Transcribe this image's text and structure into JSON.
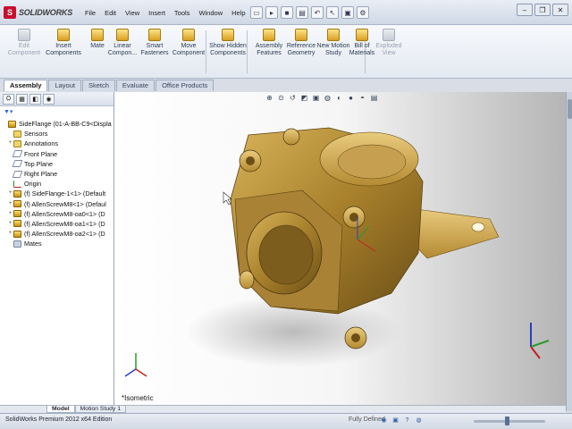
{
  "app": {
    "title": "SOLIDWORKS",
    "logo_mark": "S"
  },
  "menu": [
    "File",
    "Edit",
    "View",
    "Insert",
    "Tools",
    "Window",
    "Help"
  ],
  "quick_access": [
    "new-icon",
    "open-icon",
    "save-icon",
    "print-icon",
    "undo-icon",
    "select-icon",
    "rebuild-icon",
    "options-icon"
  ],
  "window_controls": [
    "minimize-icon",
    "restore-icon",
    "close-icon"
  ],
  "commands": [
    {
      "label": "Edit Component",
      "icon": "edit-component-icon",
      "enabled": false
    },
    {
      "label": "Insert Components",
      "icon": "insert-components-icon",
      "enabled": true
    },
    {
      "label": "Mate",
      "icon": "mate-icon",
      "enabled": true
    },
    {
      "label": "Linear Compon...",
      "icon": "linear-pattern-icon",
      "enabled": true
    },
    {
      "label": "Smart Fasteners",
      "icon": "smart-fasteners-icon",
      "enabled": true
    },
    {
      "label": "Move Component",
      "icon": "move-component-icon",
      "enabled": true
    },
    {
      "label": "Show Hidden Components",
      "icon": "show-hidden-icon",
      "enabled": true
    },
    {
      "label": "Assembly Features",
      "icon": "assembly-features-icon",
      "enabled": true
    },
    {
      "label": "Reference Geometry",
      "icon": "reference-geometry-icon",
      "enabled": true
    },
    {
      "label": "New Motion Study",
      "icon": "motion-study-icon",
      "enabled": true
    },
    {
      "label": "Bill of Materials",
      "icon": "bom-icon",
      "enabled": true
    },
    {
      "label": "Exploded View",
      "icon": "exploded-view-icon",
      "enabled": false
    }
  ],
  "tabs": [
    {
      "label": "Assembly",
      "active": true
    },
    {
      "label": "Layout",
      "active": false
    },
    {
      "label": "Sketch",
      "active": false
    },
    {
      "label": "Evaluate",
      "active": false
    },
    {
      "label": "Office Products",
      "active": false
    }
  ],
  "feature_tree": [
    {
      "label": "SideFlange  (01-A-BB-C9<Displa",
      "icon": "assembly",
      "expander": "",
      "indent": 0
    },
    {
      "label": "Sensors",
      "icon": "folder",
      "expander": "",
      "indent": 1
    },
    {
      "label": "Annotations",
      "icon": "folder",
      "expander": "+",
      "indent": 1
    },
    {
      "label": "Front Plane",
      "icon": "plane",
      "expander": "",
      "indent": 1
    },
    {
      "label": "Top Plane",
      "icon": "plane",
      "expander": "",
      "indent": 1
    },
    {
      "label": "Right Plane",
      "icon": "plane",
      "expander": "",
      "indent": 1
    },
    {
      "label": "Origin",
      "icon": "origin",
      "expander": "",
      "indent": 1
    },
    {
      "label": "(f) SideFlange-1<1> (Default",
      "icon": "part",
      "expander": "+",
      "indent": 1
    },
    {
      "label": "(f) AllenScrewM8<1> (Defaul",
      "icon": "part",
      "expander": "+",
      "indent": 1
    },
    {
      "label": "(f) AllenScrewM8-oa0<1> (D",
      "icon": "part",
      "expander": "+",
      "indent": 1
    },
    {
      "label": "(f) AllenScrewM8-oa1<1> (D",
      "icon": "part",
      "expander": "+",
      "indent": 1
    },
    {
      "label": "(f) AllenScrewM8-oa2<1> (D",
      "icon": "part",
      "expander": "+",
      "indent": 1
    },
    {
      "label": "Mates",
      "icon": "mate",
      "expander": "",
      "indent": 1
    }
  ],
  "viewport": {
    "view_name": "*Isometric",
    "headsup_icons": [
      "zoom-to-fit-icon",
      "zoom-area-icon",
      "previous-view-icon",
      "section-view-icon",
      "view-orientation-icon",
      "display-style-icon",
      "hide-show-icon",
      "edit-appearance-icon",
      "scene-icon",
      "view-settings-icon"
    ],
    "corner_icons": [
      "triad-icon",
      "restore-icon",
      "tile-icon",
      "close-icon"
    ]
  },
  "bottom_tabs": [
    {
      "label": "Model",
      "active": true
    },
    {
      "label": "Motion Study 1",
      "active": false
    }
  ],
  "status": {
    "text": "SolidWorks Premium 2012 x64 Edition",
    "right": "Fully Defined"
  }
}
